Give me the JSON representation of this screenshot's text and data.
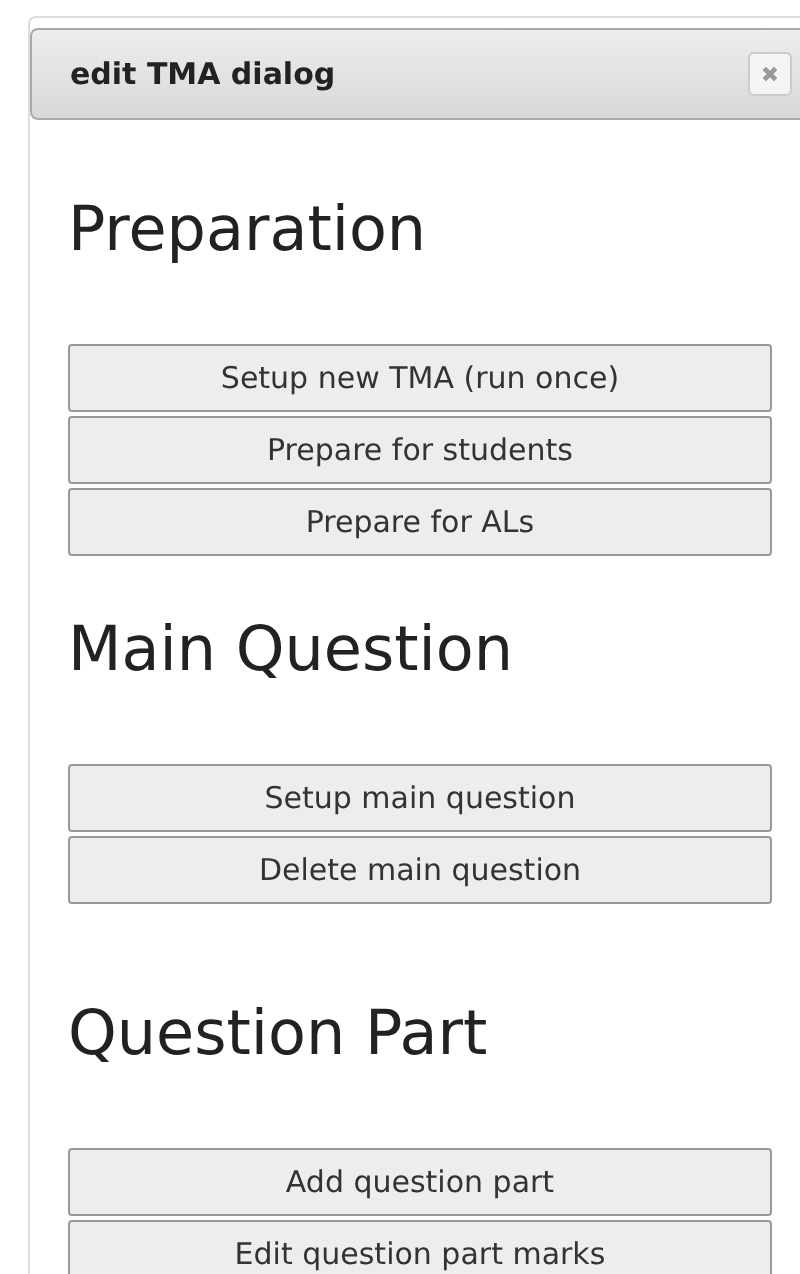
{
  "window": {
    "title": "edit TMA dialog",
    "close": "✖"
  },
  "sections": [
    {
      "heading": "Preparation",
      "buttons": [
        "Setup new TMA (run once)",
        "Prepare for students",
        "Prepare for ALs"
      ]
    },
    {
      "heading": "Main Question",
      "buttons": [
        "Setup main question",
        "Delete main question"
      ]
    },
    {
      "heading": "Question Part",
      "buttons": [
        "Add question part",
        "Edit question part marks"
      ]
    }
  ]
}
